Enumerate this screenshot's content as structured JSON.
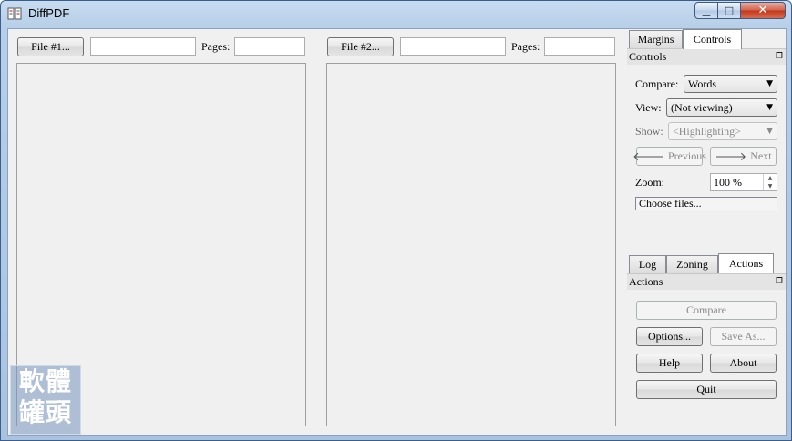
{
  "window": {
    "title": "DiffPDF",
    "minimize_icon": "minimize-icon",
    "maximize_icon": "maximize-icon",
    "close_icon": "close-icon"
  },
  "file1": {
    "button": "File #1...",
    "path": "",
    "pages_label": "Pages:",
    "pages": ""
  },
  "file2": {
    "button": "File #2...",
    "path": "",
    "pages_label": "Pages:",
    "pages": ""
  },
  "top_tabs": [
    {
      "label": "Margins",
      "active": false
    },
    {
      "label": "Controls",
      "active": true
    }
  ],
  "controls_dock": {
    "title": "Controls",
    "compare_label": "Compare:",
    "compare_value": "Words",
    "view_label": "View:",
    "view_value": "(Not viewing)",
    "show_label": "Show:",
    "show_value": "<Highlighting>",
    "previous": "Previous",
    "next": "Next",
    "zoom_label": "Zoom:",
    "zoom_value": "100 %",
    "choose_files": "Choose files..."
  },
  "bottom_tabs": [
    {
      "label": "Log",
      "active": false
    },
    {
      "label": "Zoning",
      "active": false
    },
    {
      "label": "Actions",
      "active": true
    }
  ],
  "actions_dock": {
    "title": "Actions",
    "compare": "Compare",
    "options": "Options...",
    "save_as": "Save As...",
    "help": "Help",
    "about": "About",
    "quit": "Quit"
  },
  "watermark": {
    "line1": "軟體",
    "line2": "罐頭"
  }
}
